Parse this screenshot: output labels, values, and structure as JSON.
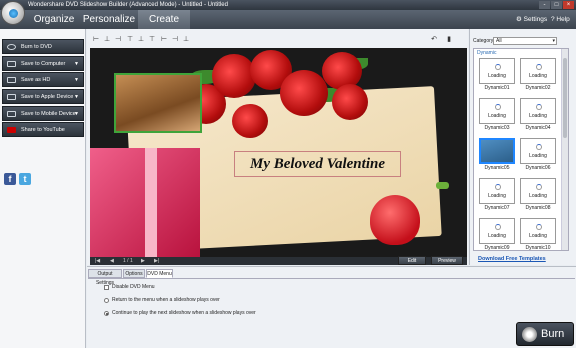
{
  "window": {
    "title": "Wondershare DVD Slideshow Builder (Advanced Mode) - Untitled - Untitled",
    "min": "-",
    "max": "□",
    "close": "×"
  },
  "menu": {
    "tabs": [
      "Organize",
      "Personalize",
      "Create"
    ],
    "selected": "Create",
    "settings": "Settings",
    "help": "Help"
  },
  "left": {
    "items": [
      "Burn to DVD",
      "Save to Computer",
      "Save as HD",
      "Save to Apple Device",
      "Save to Mobile Device",
      "Share to YouTube"
    ],
    "social": [
      "f",
      "t"
    ]
  },
  "preview": {
    "title_text": "My Beloved Valentine",
    "page": "1 / 1",
    "edit_label": "Edit",
    "preview_label": "Preview"
  },
  "templates": {
    "category_label": "Category",
    "category_value": "All",
    "group": "Dynamic",
    "loading": "Loading",
    "items": [
      "Dynamic01",
      "Dynamic02",
      "Dynamic03",
      "Dynamic04",
      "Dynamic05",
      "Dynamic06",
      "Dynamic07",
      "Dynamic08",
      "Dynamic09",
      "Dynamic10"
    ],
    "selected": "Dynamic05",
    "download_link": "Download Free Templates"
  },
  "bottom": {
    "tabs": [
      "Output Settings",
      "Options",
      "DVD Menu"
    ],
    "selected_tab": "DVD Menu",
    "disable_menu": "Disable DVD Menu",
    "return_option": "Return to the menu when a slideshow plays over",
    "continue_option": "Continue to play the next slideshow when a slideshow plays over"
  },
  "burn_label": "Burn",
  "colors": {
    "accent": "#1b57b5",
    "dark_panel": "#2c333b",
    "selection": "#1f86ff"
  }
}
